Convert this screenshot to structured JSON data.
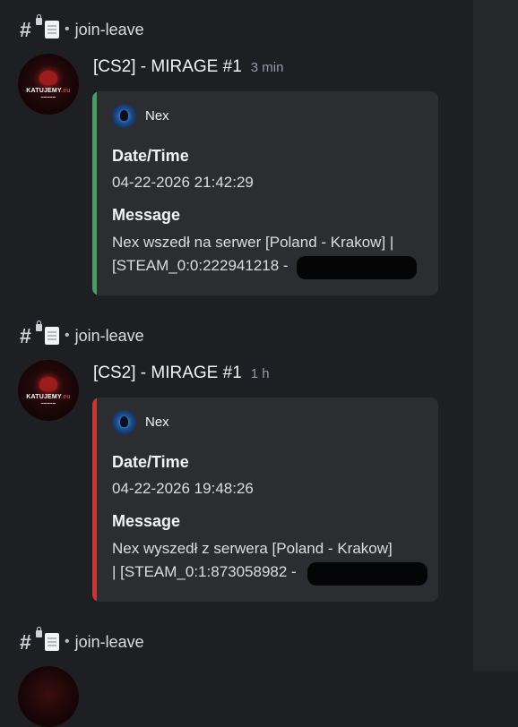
{
  "channel": {
    "name": "join-leave",
    "separator": "•",
    "icons": [
      "hash-lock-icon",
      "document-icon"
    ]
  },
  "messages": [
    {
      "author": "[CS2] - MIRAGE #1",
      "time": "3 min",
      "avatar_text": "KATUJEMY.eu",
      "embed": {
        "color": "#3ba55d",
        "author_name": "Nex",
        "fields": [
          {
            "name": "Date/Time",
            "value": "04-22-2026 21:42:29"
          },
          {
            "name": "Message",
            "value_line1": "Nex wszedł na serwer [Poland - Krakow] |",
            "value_line2": "[STEAM_0:0:222941218 -"
          }
        ]
      }
    },
    {
      "author": "[CS2] - MIRAGE #1",
      "time": "1 h",
      "avatar_text": "KATUJEMY.eu",
      "embed": {
        "color": "#e12c2c",
        "author_name": "Nex",
        "fields": [
          {
            "name": "Date/Time",
            "value": "04-22-2026 19:48:26"
          },
          {
            "name": "Message",
            "value_line1": "Nex wyszedł z serwera [Poland - Krakow]",
            "value_line2": "| [STEAM_0:1:873058982 -"
          }
        ]
      }
    }
  ]
}
